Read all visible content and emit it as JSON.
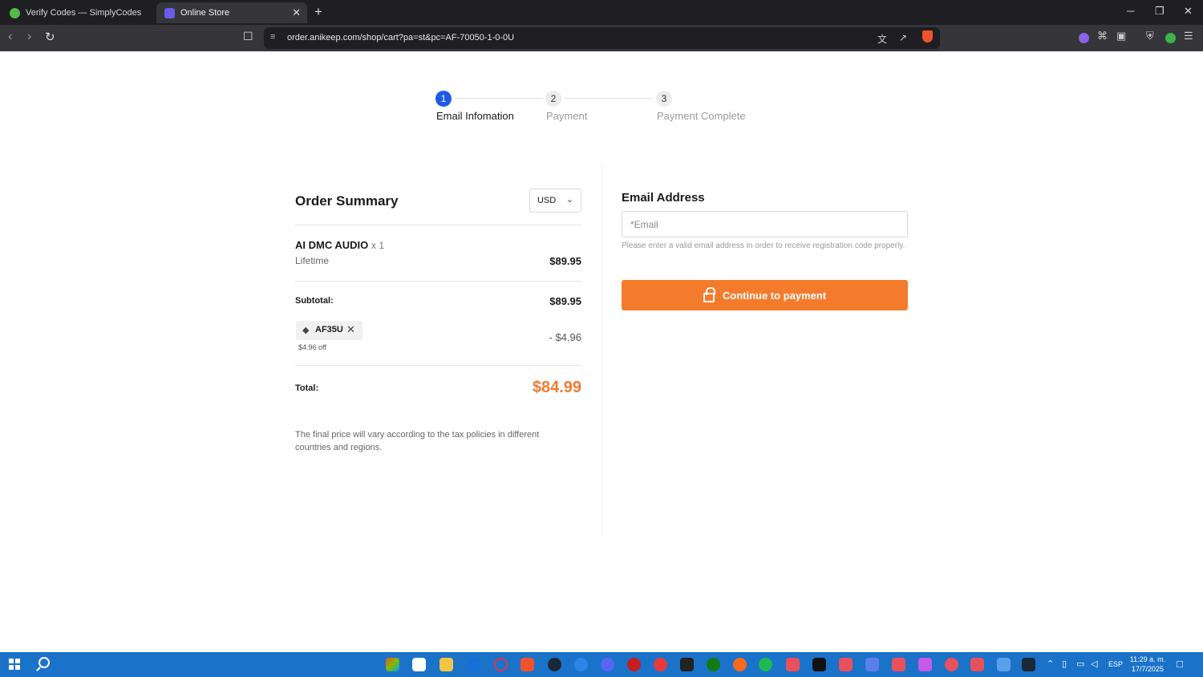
{
  "browser": {
    "tabs": [
      {
        "title": "Verify Codes — SimplyCodes"
      },
      {
        "title": "Online Store"
      }
    ],
    "url": "order.anikeep.com/shop/cart?pa=st&pc=AF-70050-1-0-0U",
    "new_tab_symbol": "+",
    "close_symbol": "✕",
    "window_controls": {
      "minimize": "─",
      "restore": "❐",
      "close": "✕"
    }
  },
  "stepper": {
    "steps": [
      {
        "number": "1",
        "label": "Email Infomation",
        "active": true
      },
      {
        "number": "2",
        "label": "Payment",
        "active": false
      },
      {
        "number": "3",
        "label": "Payment Complete",
        "active": false
      }
    ]
  },
  "order_summary": {
    "title": "Order Summary",
    "currency": "USD",
    "product": {
      "name": "AI DMC AUDIO",
      "quantity": "x 1",
      "plan": "Lifetime",
      "price": "$89.95"
    },
    "subtotal": {
      "label": "Subtotal:",
      "value": "$89.95"
    },
    "coupon": {
      "code": "AF35U",
      "off_text": "$4.96 off",
      "amount": "- $4.96"
    },
    "total": {
      "label": "Total:",
      "value": "$84.99"
    },
    "tax_note": "The final price will vary according to the tax policies in different countries and regions."
  },
  "email_section": {
    "title": "Email Address",
    "placeholder": "*Email",
    "value": "",
    "hint": "Please enter a valid email address in order to receive registration code properly.",
    "button_label": "Continue to payment"
  },
  "taskbar": {
    "language": "ESP",
    "time": "11:29 a. m.",
    "date": "17/7/2025"
  },
  "colors": {
    "accent_blue": "#1d5be6",
    "accent_orange": "#f57b2c",
    "total_orange": "#f07a32",
    "taskbar_blue": "#1b72c9"
  }
}
